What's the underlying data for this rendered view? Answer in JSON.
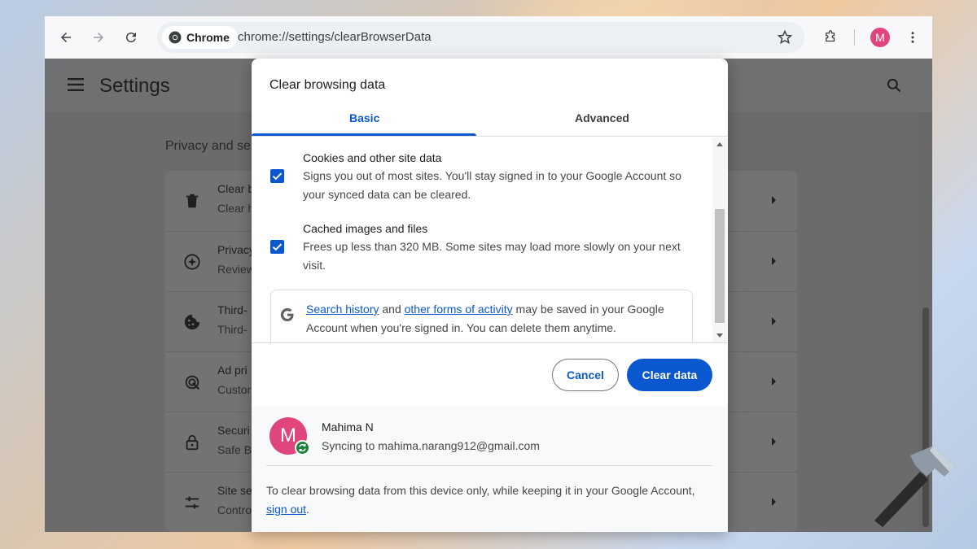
{
  "browser": {
    "chip_label": "Chrome",
    "url": "chrome://settings/clearBrowserData",
    "profile_initial": "M"
  },
  "settings": {
    "title": "Settings",
    "section_label": "Privacy and se",
    "rows": [
      {
        "title": "Clear b",
        "subtitle": "Clear h",
        "icon": "trash-icon"
      },
      {
        "title": "Privacy",
        "subtitle": "Review",
        "icon": "privacy-guide-icon"
      },
      {
        "title": "Third-",
        "subtitle": "Third-",
        "icon": "cookie-icon"
      },
      {
        "title": "Ad pri",
        "subtitle": "Custor",
        "icon": "ad-privacy-icon"
      },
      {
        "title": "Securi",
        "subtitle": "Safe B",
        "icon": "lock-icon"
      },
      {
        "title": "Site se",
        "subtitle": "Contro",
        "icon": "sliders-icon"
      }
    ]
  },
  "dialog": {
    "title": "Clear browsing data",
    "tabs": {
      "basic": "Basic",
      "advanced": "Advanced"
    },
    "options": [
      {
        "title": "Cookies and other site data",
        "description": "Signs you out of most sites. You'll stay signed in to your Google Account so your synced data can be cleared.",
        "checked": true
      },
      {
        "title": "Cached images and files",
        "description": "Frees up less than 320 MB. Some sites may load more slowly on your next visit.",
        "checked": true
      }
    ],
    "google_info": {
      "link1": "Search history",
      "text1": " and ",
      "link2": "other forms of activity",
      "text2": " may be saved in your Google Account when you're signed in. You can delete them anytime."
    },
    "buttons": {
      "cancel": "Cancel",
      "clear": "Clear data"
    },
    "account": {
      "initial": "M",
      "name": "Mahima N",
      "sync_text": "Syncing to mahima.narang912@gmail.com"
    },
    "footer": {
      "text": "To clear browsing data from this device only, while keeping it in your Google Account, ",
      "link": "sign out",
      "end": "."
    }
  },
  "colors": {
    "accent": "#0b57d0",
    "avatar": "#e0457b",
    "sync": "#188038"
  }
}
